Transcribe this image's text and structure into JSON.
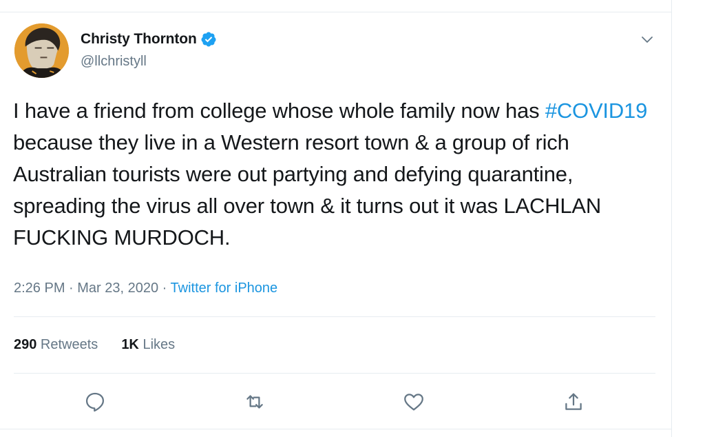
{
  "user": {
    "display_name": "Christy Thornton",
    "handle": "@llchristyll",
    "verified": true,
    "avatar_icon": "avatar-photo"
  },
  "tweet": {
    "text_before": "I have a friend from college whose whole family now has ",
    "hashtag": "#COVID19",
    "text_after": " because they live in a Western resort town & a group of rich Australian tourists were out partying and defying quarantine, spreading the virus all over town & it turns out it was LACHLAN FUCKING MURDOCH."
  },
  "meta": {
    "time": "2:26 PM",
    "sep1": " · ",
    "date": "Mar 23, 2020",
    "sep2": " · ",
    "source": "Twitter for iPhone"
  },
  "stats": {
    "retweets_count": "290",
    "retweets_label": " Retweets",
    "likes_count": "1K",
    "likes_label": " Likes"
  },
  "actions": [
    "reply-icon",
    "retweet-icon",
    "like-icon",
    "share-icon"
  ],
  "colors": {
    "accent": "#1b95e0",
    "text": "#14171a",
    "muted": "#657786",
    "border": "#e6ecf0",
    "verified": "#1da1f2"
  }
}
